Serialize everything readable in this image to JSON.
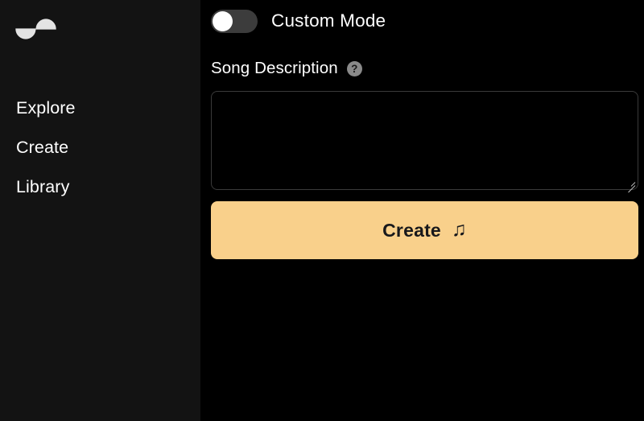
{
  "app": {
    "background_color": "#000000",
    "accent_color": "#f9d08b"
  },
  "sidebar": {
    "background_color": "#131313",
    "logo": {
      "name": "app-logo",
      "shape": "s-curve-wave",
      "color": "#e3e3e3"
    },
    "items": [
      {
        "label": "Explore"
      },
      {
        "label": "Create"
      },
      {
        "label": "Library"
      }
    ]
  },
  "main": {
    "custom_mode": {
      "label": "Custom Mode",
      "enabled": false,
      "track_color": "#3c3c3c",
      "knob_color": "#ffffff"
    },
    "song_description": {
      "label": "Song Description",
      "help_icon": "question-mark-circle-icon",
      "value": "",
      "placeholder": "",
      "border_color": "#3a3a3a"
    },
    "create_button": {
      "label": "Create",
      "icon": "music-note-icon",
      "icon_glyph": "♫",
      "background_color": "#f9d08b",
      "text_color": "#18181b"
    }
  }
}
